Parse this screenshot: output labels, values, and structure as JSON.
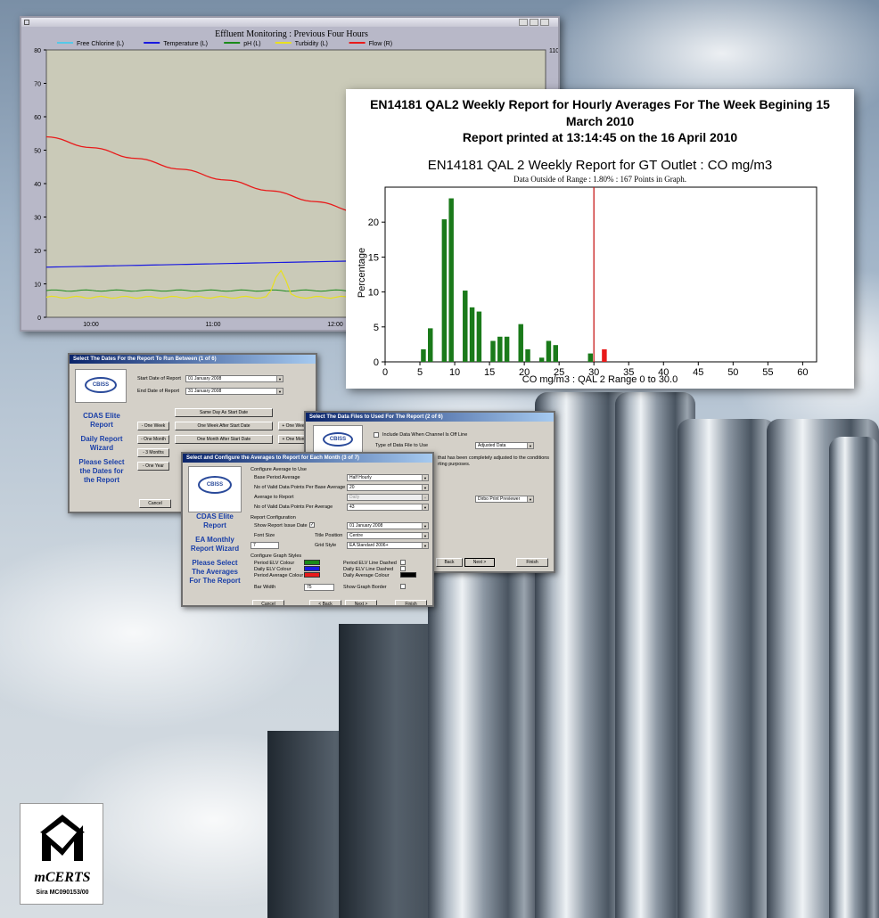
{
  "trend": {
    "title": "Effluent Monitoring : Previous Four Hours",
    "legend": [
      {
        "name": "Free Chlorine (L)",
        "color": "#55c8e8"
      },
      {
        "name": "Temperature (L)",
        "color": "#1a1ae0"
      },
      {
        "name": "pH (L)",
        "color": "#1a8a1a"
      },
      {
        "name": "Turbidity (L)",
        "color": "#e8e020"
      },
      {
        "name": "Flow (R)",
        "color": "#e81a1a"
      }
    ],
    "y_ticks": [
      "80",
      "70",
      "60",
      "50",
      "40",
      "30",
      "20",
      "10",
      "0"
    ],
    "right_tick": "1100",
    "x_ticks": [
      "10:00",
      "11:00",
      "12:00"
    ]
  },
  "report": {
    "header": "EN14181 QAL2 Weekly Report for Hourly Averages For The Week Begining 15 March 2010",
    "printed": "Report printed at 13:14:45 on the 16 April 2010",
    "title": "EN14181 QAL 2 Weekly Report for GT Outlet : CO mg/m3",
    "subtitle": "Data Outside of Range : 1.80% : 167 Points in Graph.",
    "ylabel": "Percentage",
    "xlabel": "CO mg/m3 : QAL 2 Range 0 to 30.0"
  },
  "chart_data": {
    "type": "bar",
    "title": "EN14181 QAL 2 Weekly Report for GT Outlet : CO mg/m3",
    "xlabel": "CO mg/m3 : QAL 2 Range 0 to 30.0",
    "ylabel": "Percentage",
    "xlim": [
      0,
      62
    ],
    "ylim": [
      0,
      25
    ],
    "x_ticks": [
      0,
      5,
      10,
      15,
      20,
      25,
      30,
      35,
      40,
      45,
      50,
      55,
      60
    ],
    "y_ticks": [
      0,
      5,
      10,
      15,
      20
    ],
    "limit_line": 30,
    "bars": [
      {
        "x": 5,
        "y": 1.8,
        "color": "#1a7a1a"
      },
      {
        "x": 6,
        "y": 4.8,
        "color": "#1a7a1a"
      },
      {
        "x": 8,
        "y": 20.4,
        "color": "#1a7a1a"
      },
      {
        "x": 9,
        "y": 23.4,
        "color": "#1a7a1a"
      },
      {
        "x": 11,
        "y": 10.2,
        "color": "#1a7a1a"
      },
      {
        "x": 12,
        "y": 7.8,
        "color": "#1a7a1a"
      },
      {
        "x": 13,
        "y": 7.2,
        "color": "#1a7a1a"
      },
      {
        "x": 15,
        "y": 3.0,
        "color": "#1a7a1a"
      },
      {
        "x": 16,
        "y": 3.6,
        "color": "#1a7a1a"
      },
      {
        "x": 17,
        "y": 3.6,
        "color": "#1a7a1a"
      },
      {
        "x": 19,
        "y": 5.4,
        "color": "#1a7a1a"
      },
      {
        "x": 20,
        "y": 1.8,
        "color": "#1a7a1a"
      },
      {
        "x": 22,
        "y": 0.6,
        "color": "#1a7a1a"
      },
      {
        "x": 23,
        "y": 3.0,
        "color": "#1a7a1a"
      },
      {
        "x": 24,
        "y": 2.4,
        "color": "#1a7a1a"
      },
      {
        "x": 29,
        "y": 1.2,
        "color": "#1a7a1a"
      },
      {
        "x": 31,
        "y": 1.8,
        "color": "#e81a1a"
      }
    ]
  },
  "dlg1": {
    "title": "Select The Dates For the Report To Run Between (1 of 6)",
    "logo": "CBISS",
    "side1": "CDAS Elite Report",
    "side2": "Daily Report Wizard",
    "side3": "Please Select the Dates for the Report",
    "start_label": "Start Date of Report",
    "start_value": "01   January   2008",
    "end_label": "End Date of Report",
    "end_value": "31   January   2008",
    "btn_same": "Same Day As Start Date",
    "btn_minus_week": "- One Week",
    "btn_week_after": "One Week After Start Date",
    "btn_plus_week": "+ One Wee",
    "btn_minus_month": "- One Month",
    "btn_month_after": "One Month After Start Date",
    "btn_plus_month": "+ One Mon",
    "btn_minus_3m": "- 3 Months",
    "btn_minus_year": "- One Year",
    "cancel": "Cancel"
  },
  "dlg2": {
    "title": "Select The Data Files to Used For The Report (2 of 6)",
    "logo": "CBISS",
    "include_label": "Include Data When Channel Is Off Line",
    "type_label": "Type of Data File to Use",
    "type_value": "Adjusted Data",
    "note1": "that has been completely adjusted to the conditions",
    "note2": "rting purposes.",
    "output_value": "Dirbo Print Previewer",
    "back": "Back",
    "next": "Next >",
    "finish": "Finish"
  },
  "dlg3": {
    "title": "Select and Configure the Averages to Report for Each Month (3 of 7)",
    "logo": "CBISS",
    "side1": "CDAS Elite Report",
    "side2": "EA Monthly Report Wizard",
    "side3": "Please Select The Averages For The Report",
    "sec_avg": "Configure Average to Use",
    "base_label": "Base Period Average",
    "base_value": "Half Hourly",
    "valid_base_label": "No of Valid Data Points Per Base Average",
    "valid_base_value": "20",
    "avg_report_label": "Average to Report",
    "avg_report_value": "Daily",
    "valid_avg_label": "No of Valid Data Points Per Average",
    "valid_avg_value": "43",
    "sec_rep": "Report Configuration",
    "show_date_label": "Show Report Issue Date",
    "date_value": "01   January   2008",
    "font_label": "Font Size",
    "font_value": "7",
    "title_pos_label": "Title Position",
    "title_pos_value": "Centre",
    "grid_label": "Grid Style",
    "grid_value": "EA Standard 2006+",
    "sec_graph": "Configure Graph Styles",
    "period_elv": "Period ELV Colour",
    "daily_elv": "Daily ELV Colour",
    "period_avg": "Period Average Colour",
    "period_dashed": "Period ELV Line Dashed",
    "daily_dashed": "Daily ELV Line Dashed",
    "daily_avg": "Daily Average Colour",
    "bar_width_label": "Bar Width",
    "bar_width_value": "75",
    "border_label": "Show Graph Border",
    "cancel": "Cancel",
    "back": "< Back",
    "next": "Next >",
    "finish": "Finish"
  },
  "mcerts": {
    "brand": "mCERTS",
    "cert": "Sira MC090153/00"
  }
}
